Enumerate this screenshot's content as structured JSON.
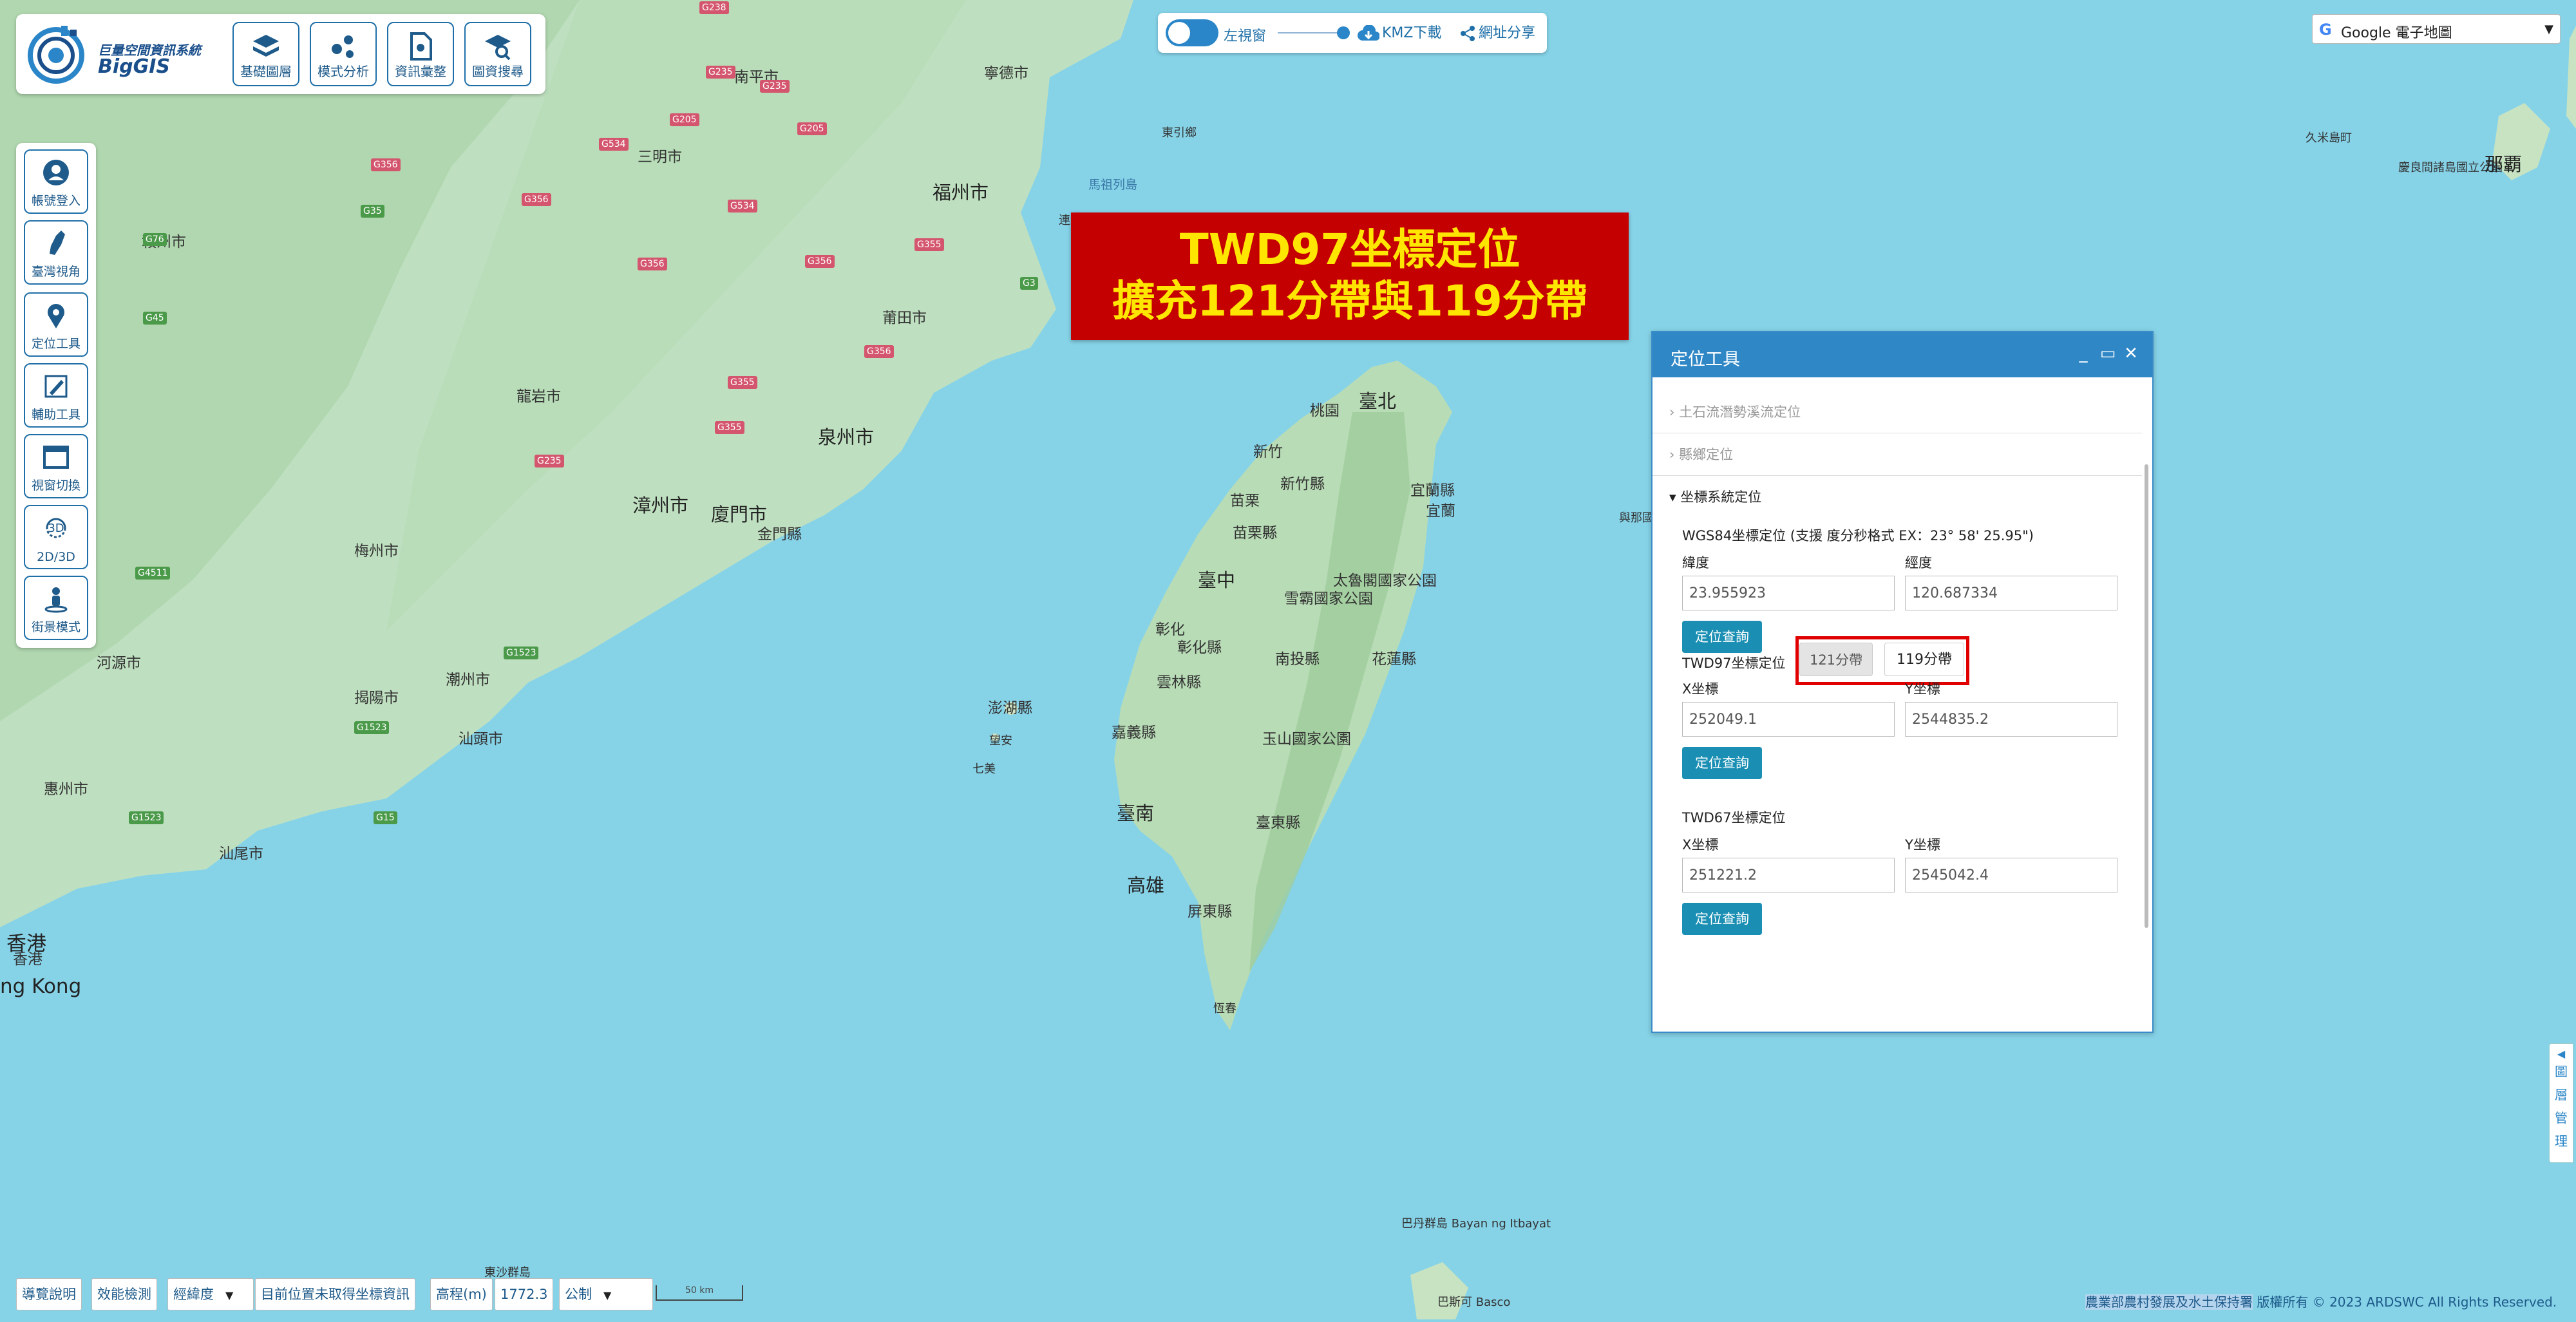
{
  "app": {
    "logo_cn": "巨量空間資訊系統",
    "logo_en": "BigGIS"
  },
  "toolbar": {
    "basemap_layers": "基礎圖層",
    "model_analysis": "模式分析",
    "info_compendium": "資訊彙整",
    "map_search": "圖資搜尋"
  },
  "sidebar": {
    "login": "帳號登入",
    "taiwan_view": "臺灣視角",
    "locate_tool": "定位工具",
    "aux_tool": "輔助工具",
    "window_switch": "視窗切換",
    "dim_top": "3D",
    "dim_bottom": "2D/3D",
    "streetview": "街景模式"
  },
  "topctrl": {
    "left_view": "左視窗",
    "kmz": "KMZ下載",
    "share": "網址分享"
  },
  "basemap_select": {
    "g": "G",
    "value": "Google 電子地圖"
  },
  "announcement": {
    "line1": "TWD97坐標定位",
    "line2": "擴充121分帶與119分帶"
  },
  "panel": {
    "title": "定位工具",
    "min": "_",
    "max": "▭",
    "close": "✕",
    "acc1": "土石流潛勢溪流定位",
    "acc2": "縣鄉定位",
    "acc3": "坐標系統定位",
    "wgs_title": "WGS84坐標定位 (支援 度分秒格式 EX：23° 58' 25.95\")",
    "lat_label": "緯度",
    "lon_label": "經度",
    "lat": "23.955923",
    "lon": "120.687334",
    "query": "定位查詢",
    "twd97_title": "TWD97坐標定位",
    "zone121": "121分帶",
    "zone119": "119分帶",
    "x_label": "X坐標",
    "y_label": "Y坐標",
    "twd97_x": "252049.1",
    "twd97_y": "2544835.2",
    "twd67_title": "TWD67坐標定位",
    "twd67_x": "251221.2",
    "twd67_y": "2545042.4"
  },
  "layertab": {
    "arrow": "◀",
    "chars": [
      "圖",
      "層",
      "管",
      "理"
    ]
  },
  "statusbar": {
    "guide": "導覽說明",
    "perf": "效能檢測",
    "coord_format": "經緯度",
    "position": "目前位置未取得坐標資訊",
    "elev_label": "高程(m)",
    "elev_value": "1772.3",
    "unit": "公制",
    "scale": "50 km"
  },
  "copyright": {
    "org": "農業部農村發展及水土保持署",
    "rest": " 版權所有 © 2023 ARDSWC All Rights Reserved."
  },
  "map": {
    "labels": [
      {
        "text": "南平市",
        "cls": ""
      },
      {
        "text": "寧德市",
        "cls": ""
      },
      {
        "text": "三明市",
        "cls": ""
      },
      {
        "text": "福州市",
        "cls": "big"
      },
      {
        "text": "莆田市",
        "cls": ""
      },
      {
        "text": "泉州市",
        "cls": "big"
      },
      {
        "text": "漳州市",
        "cls": "big"
      },
      {
        "text": "廈門市",
        "cls": "big"
      },
      {
        "text": "金門縣",
        "cls": ""
      },
      {
        "text": "龍岩市",
        "cls": ""
      },
      {
        "text": "梅州市",
        "cls": ""
      },
      {
        "text": "贛州市",
        "cls": ""
      },
      {
        "text": "河源市",
        "cls": ""
      },
      {
        "text": "揭陽市",
        "cls": ""
      },
      {
        "text": "潮州市",
        "cls": ""
      },
      {
        "text": "汕頭市",
        "cls": ""
      },
      {
        "text": "汕尾市",
        "cls": ""
      },
      {
        "text": "惠州市",
        "cls": ""
      },
      {
        "text": "香港",
        "cls": "huge"
      },
      {
        "text": "香港",
        "cls": ""
      },
      {
        "text": "ng Kong",
        "cls": "huge"
      },
      {
        "text": "臺北",
        "cls": "big"
      },
      {
        "text": "桃園",
        "cls": ""
      },
      {
        "text": "新竹",
        "cls": ""
      },
      {
        "text": "新竹縣",
        "cls": ""
      },
      {
        "text": "苗栗",
        "cls": ""
      },
      {
        "text": "苗栗縣",
        "cls": ""
      },
      {
        "text": "臺中",
        "cls": "big"
      },
      {
        "text": "彰化",
        "cls": ""
      },
      {
        "text": "彰化縣",
        "cls": ""
      },
      {
        "text": "南投縣",
        "cls": ""
      },
      {
        "text": "雲林縣",
        "cls": ""
      },
      {
        "text": "嘉義縣",
        "cls": ""
      },
      {
        "text": "臺南",
        "cls": "big"
      },
      {
        "text": "高雄",
        "cls": "big"
      },
      {
        "text": "屏東縣",
        "cls": ""
      },
      {
        "text": "臺東縣",
        "cls": ""
      },
      {
        "text": "花蓮縣",
        "cls": ""
      },
      {
        "text": "宜蘭縣",
        "cls": ""
      },
      {
        "text": "宜蘭",
        "cls": ""
      },
      {
        "text": "太魯閣國家公園",
        "cls": ""
      },
      {
        "text": "雪霸國家公園",
        "cls": ""
      },
      {
        "text": "玉山國家公園",
        "cls": ""
      },
      {
        "text": "澎湖縣",
        "cls": ""
      },
      {
        "text": "望安",
        "cls": "island"
      },
      {
        "text": "七美",
        "cls": "island"
      },
      {
        "text": "恆春",
        "cls": "island"
      },
      {
        "text": "馬祖列島",
        "cls": "sea"
      },
      {
        "text": "連江縣",
        "cls": "island"
      },
      {
        "text": "東引鄉",
        "cls": "island"
      },
      {
        "text": "東沙群島",
        "cls": "island"
      },
      {
        "text": "久米島町",
        "cls": "island"
      },
      {
        "text": "慶良間諸島國立公園",
        "cls": "island"
      },
      {
        "text": "那覇",
        "cls": "big"
      },
      {
        "text": "巴丹群島 Bayan ng Itbayat",
        "cls": "island"
      },
      {
        "text": "巴斯可 Basco",
        "cls": "island"
      },
      {
        "text": "與那國町",
        "cls": "island"
      }
    ]
  }
}
